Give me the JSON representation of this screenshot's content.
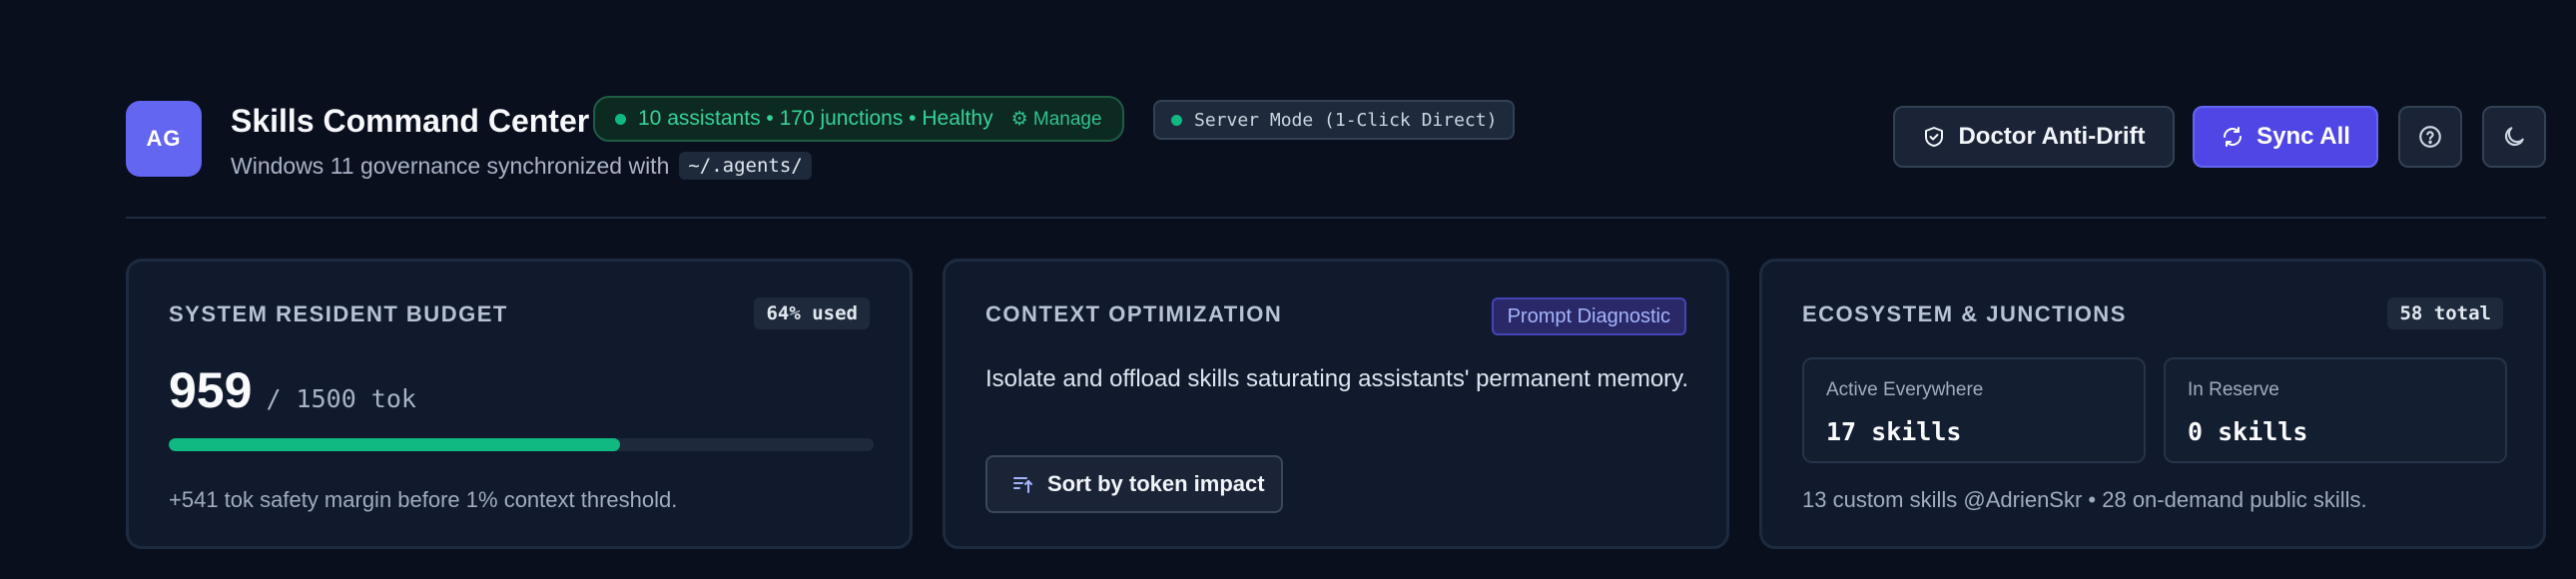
{
  "header": {
    "logo_text": "AG",
    "title": "Skills Command Center",
    "health_text": "10 assistants • 170 junctions • Healthy",
    "manage_label": "⚙ Manage",
    "server_mode": "Server Mode (1-Click Direct)",
    "subtitle_prefix": "Windows 11 governance synchronized with",
    "subtitle_path": "~/.agents/",
    "doctor_label": "Doctor Anti-Drift",
    "sync_label": "Sync All"
  },
  "budget": {
    "label": "SYSTEM RESIDENT BUDGET",
    "badge": "64% used",
    "value": "959",
    "of_total": "/ 1500 tok",
    "fill_fraction": 0.64,
    "note": "+541 tok safety margin before 1% context threshold."
  },
  "context": {
    "label": "CONTEXT OPTIMIZATION",
    "badge": "Prompt Diagnostic",
    "description": "Isolate and offload skills saturating assistants' permanent memory.",
    "button_label": "Sort by token impact"
  },
  "ecosystem": {
    "label": "ECOSYSTEM & JUNCTIONS",
    "badge": "58 total",
    "active_label": "Active Everywhere",
    "active_value": "17 skills",
    "reserve_label": "In Reserve",
    "reserve_value": "0 skills",
    "note": "13 custom skills @AdrienSkr • 28 on-demand public skills."
  },
  "colors": {
    "accent": "#6366f1",
    "healthy": "#10b981",
    "background": "#0a0f1d"
  }
}
